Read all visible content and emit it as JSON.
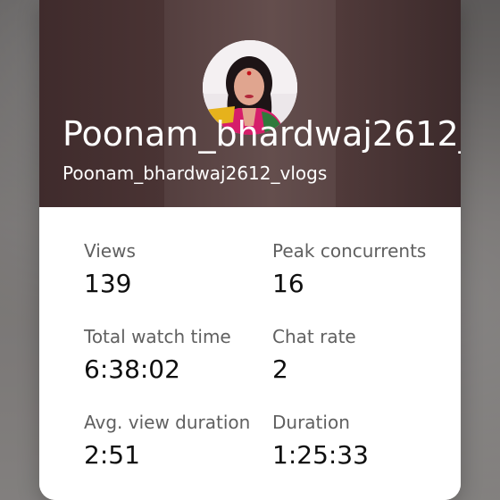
{
  "header": {
    "channel_title": "Poonam_bhardwaj2612_..",
    "channel_subtitle": "Poonam_bhardwaj2612_vlogs"
  },
  "avatar": {
    "icon": "profile-photo"
  },
  "stats": [
    {
      "label": "Views",
      "value": "139"
    },
    {
      "label": "Peak concurrents",
      "value": "16"
    },
    {
      "label": "Total watch time",
      "value": "6:38:02"
    },
    {
      "label": "Chat rate",
      "value": "2"
    },
    {
      "label": "Avg. view duration",
      "value": "2:51"
    },
    {
      "label": "Duration",
      "value": "1:25:33"
    }
  ],
  "colors": {
    "header_bg": "#4a3434",
    "card_bg": "#ffffff",
    "label_text": "#606060",
    "value_text": "#0f0f0f"
  }
}
